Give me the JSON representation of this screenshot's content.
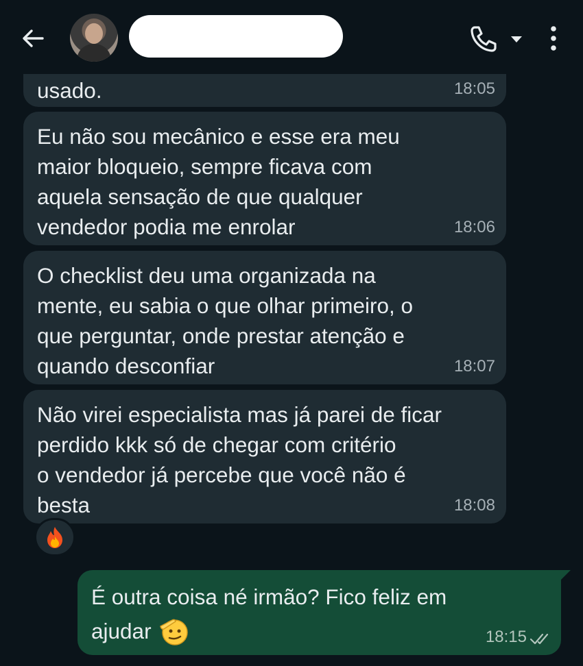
{
  "header": {
    "back_icon": "arrow-left-icon",
    "contact_name": "",
    "call_icon": "phone-icon",
    "dropdown_icon": "caret-down-icon",
    "menu_icon": "more-vert-icon"
  },
  "messages": [
    {
      "direction": "incoming",
      "text": "usado.",
      "time": "18:05"
    },
    {
      "direction": "incoming",
      "text": "Eu não sou mecânico e esse era meu\nmaior bloqueio, sempre ficava com\naquela sensação de que qualquer\nvendedor podia me enrolar",
      "time": "18:06"
    },
    {
      "direction": "incoming",
      "text": "O checklist deu uma organizada na\nmente, eu sabia o que olhar primeiro, o\nque perguntar, onde prestar atenção e\nquando desconfiar",
      "time": "18:07"
    },
    {
      "direction": "incoming",
      "text": "Não virei especialista mas já parei de ficar\nperdido kkk só de chegar com critério\no vendedor já percebe que você não é\nbesta",
      "time": "18:08"
    }
  ],
  "reaction": {
    "emoji": "🔥",
    "icon": "fire-icon"
  },
  "outgoing": {
    "line1": "É outra coisa né irmão? Fico feliz em",
    "line2": "ajudar",
    "emoji_icon": "saluting-face-icon",
    "time": "18:15",
    "status_icon": "double-check-icon"
  },
  "colors": {
    "background": "#0b141a",
    "incoming_bubble": "#1f2c33",
    "outgoing_bubble": "#144d37",
    "text": "#e9edef"
  }
}
